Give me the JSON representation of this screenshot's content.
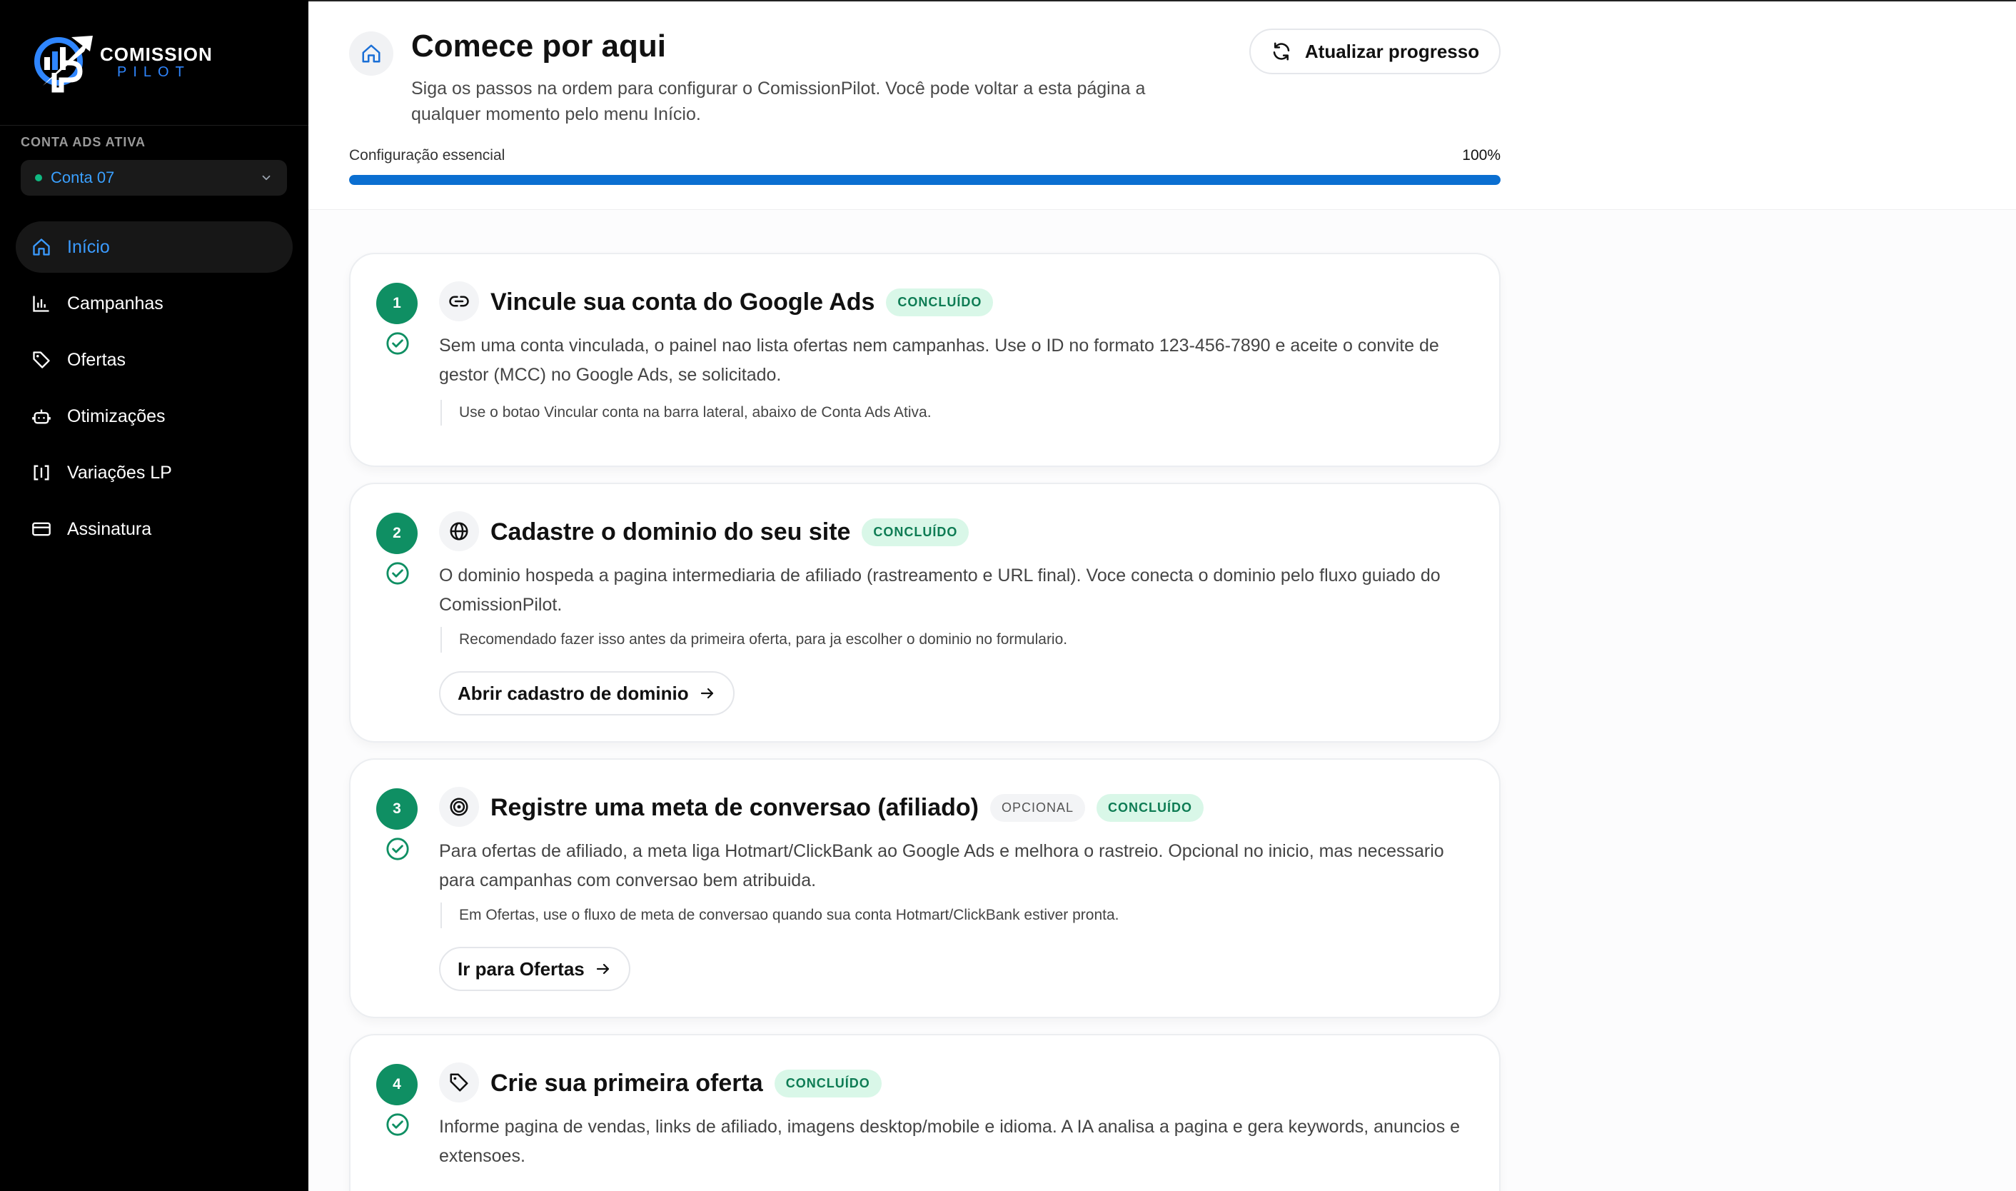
{
  "brand": {
    "line1": "COMISSION",
    "line2": "PILOT",
    "accent": "#2f86ff"
  },
  "sidebar": {
    "account_label": "CONTA ADS ATIVA",
    "account_selected": "Conta 07",
    "items": [
      {
        "label": "Início",
        "icon": "home-icon",
        "active": true
      },
      {
        "label": "Campanhas",
        "icon": "bar-chart-icon",
        "active": false
      },
      {
        "label": "Ofertas",
        "icon": "tag-icon",
        "active": false
      },
      {
        "label": "Otimizações",
        "icon": "bot-icon",
        "active": false
      },
      {
        "label": "Variações LP",
        "icon": "brackets-icon",
        "active": false
      },
      {
        "label": "Assinatura",
        "icon": "credit-card-icon",
        "active": false
      }
    ]
  },
  "header": {
    "title": "Comece por aqui",
    "subtitle": "Siga os passos na ordem para configurar o ComissionPilot. Você pode voltar a esta página a qualquer momento pelo menu Início.",
    "refresh_label": "Atualizar progresso",
    "progress_label": "Configuração essencial",
    "progress_text": "100%",
    "progress_value": 1.0
  },
  "steps": [
    {
      "number": "1",
      "title": "Vincule sua conta do Google Ads",
      "status": "CONCLUÍDO",
      "icon": "link-icon",
      "description": "Sem uma conta vinculada, o painel nao lista ofertas nem campanhas. Use o ID no formato 123-456-7890 e aceite o convite de gestor (MCC) no Google Ads, se solicitado.",
      "note": "Use o botao Vincular conta na barra lateral, abaixo de Conta Ads Ativa."
    },
    {
      "number": "2",
      "title": "Cadastre o dominio do seu site",
      "status": "CONCLUÍDO",
      "icon": "globe-icon",
      "description": "O dominio hospeda a pagina intermediaria de afiliado (rastreamento e URL final). Voce conecta o dominio pelo fluxo guiado do ComissionPilot.",
      "note": "Recomendado fazer isso antes da primeira oferta, para ja escolher o dominio no formulario.",
      "button": "Abrir cadastro de dominio"
    },
    {
      "number": "3",
      "title": "Registre uma meta de conversao (afiliado)",
      "optional": "OPCIONAL",
      "status": "CONCLUÍDO",
      "icon": "target-icon",
      "description": "Para ofertas de afiliado, a meta liga Hotmart/ClickBank ao Google Ads e melhora o rastreio. Opcional no inicio, mas necessario para campanhas com conversao bem atribuida.",
      "note": "Em Ofertas, use o fluxo de meta de conversao quando sua conta Hotmart/ClickBank estiver pronta.",
      "button": "Ir para Ofertas"
    },
    {
      "number": "4",
      "title": "Crie sua primeira oferta",
      "status": "CONCLUÍDO",
      "icon": "tag-icon",
      "description": "Informe pagina de vendas, links de afiliado, imagens desktop/mobile e idioma. A IA analisa a pagina e gera keywords, anuncios e extensoes."
    }
  ]
}
